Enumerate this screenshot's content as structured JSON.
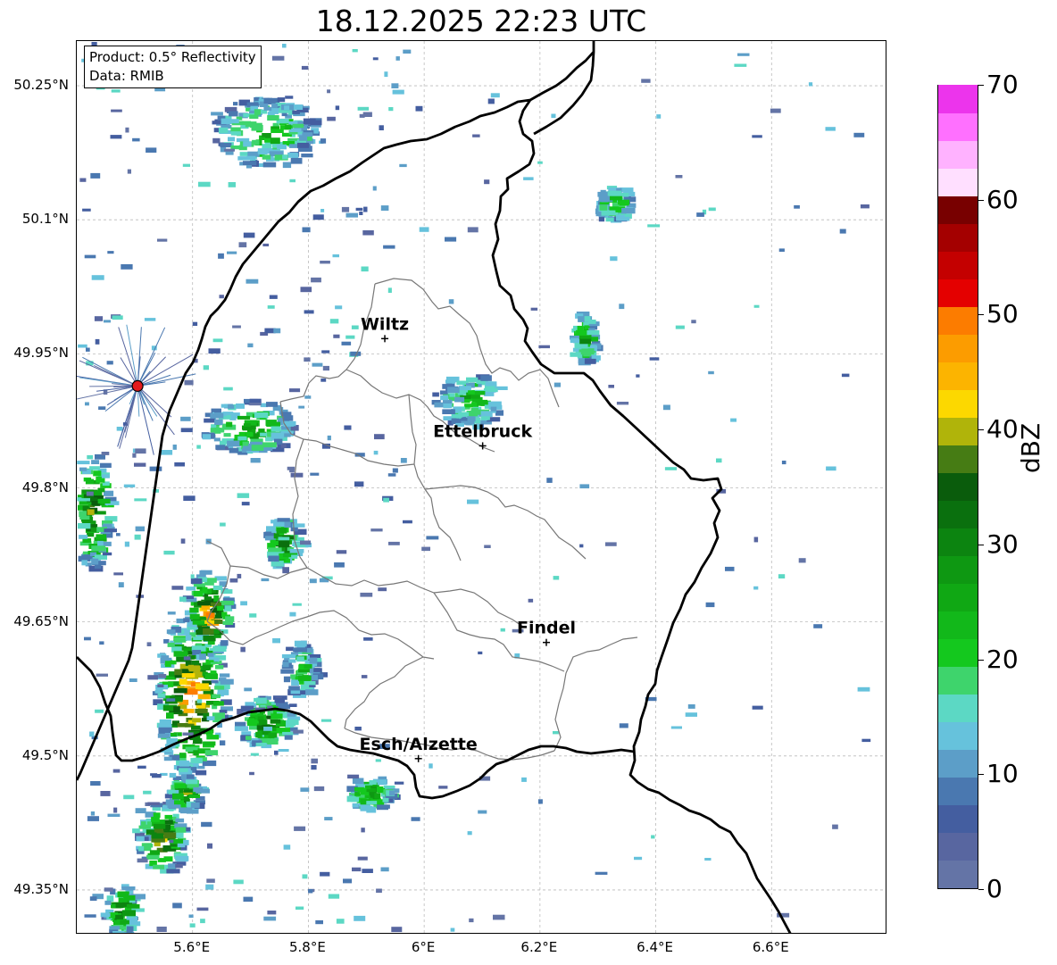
{
  "title": "18.12.2025 22:23 UTC",
  "info_box": {
    "product": "Product: 0.5° Reflectivity",
    "data": "Data: RMIB"
  },
  "axes": {
    "lon_range": [
      5.4,
      6.8
    ],
    "lat_range": [
      49.3,
      50.3
    ],
    "lat_ticks": [
      {
        "value": 50.25,
        "label": "50.25°N"
      },
      {
        "value": 50.1,
        "label": "50.1°N"
      },
      {
        "value": 49.95,
        "label": "49.95°N"
      },
      {
        "value": 49.8,
        "label": "49.8°N"
      },
      {
        "value": 49.65,
        "label": "49.65°N"
      },
      {
        "value": 49.5,
        "label": "49.5°N"
      },
      {
        "value": 49.35,
        "label": "49.35°N"
      }
    ],
    "lon_ticks": [
      {
        "value": 5.6,
        "label": "5.6°E"
      },
      {
        "value": 5.8,
        "label": "5.8°E"
      },
      {
        "value": 6.0,
        "label": "6°E"
      },
      {
        "value": 6.2,
        "label": "6.2°E"
      },
      {
        "value": 6.4,
        "label": "6.4°E"
      },
      {
        "value": 6.6,
        "label": "6.6°E"
      }
    ],
    "gridlines": true
  },
  "cities": [
    {
      "name": "Wiltz",
      "lon": 5.932,
      "lat": 49.967
    },
    {
      "name": "Ettelbruck",
      "lon": 6.101,
      "lat": 49.847
    },
    {
      "name": "Findel",
      "lon": 6.211,
      "lat": 49.627
    },
    {
      "name": "Esch/Alzette",
      "lon": 5.99,
      "lat": 49.497
    }
  ],
  "radar_site": {
    "lon": 5.505,
    "lat": 49.914,
    "color": "#e31a1c"
  },
  "colorbar": {
    "label": "dBZ",
    "min": 0,
    "max": 70,
    "ticks": [
      {
        "value": 0,
        "label": "0"
      },
      {
        "value": 10,
        "label": "10"
      },
      {
        "value": 20,
        "label": "20"
      },
      {
        "value": 30,
        "label": "30"
      },
      {
        "value": 40,
        "label": "40"
      },
      {
        "value": 50,
        "label": "50"
      },
      {
        "value": 60,
        "label": "60"
      },
      {
        "value": 70,
        "label": "70"
      }
    ],
    "colors": [
      "#6474a6",
      "#5866a0",
      "#445ea0",
      "#4a78b0",
      "#5c9ec8",
      "#66c2dc",
      "#5cd8c4",
      "#3ed46c",
      "#14c81e",
      "#12b81a",
      "#10a814",
      "#0e9812",
      "#0c8410",
      "#0a700e",
      "#0a5c0c",
      "#467c14",
      "#b0b40a",
      "#fcd800",
      "#fcb400",
      "#fc9c00",
      "#fc7c00",
      "#e40000",
      "#c40000",
      "#a40000",
      "#780000",
      "#ffdfff",
      "#ffb2ff",
      "#ff70ff",
      "#ec34ec"
    ]
  },
  "echo_clusters": [
    {
      "lon": 5.59,
      "lat": 49.57,
      "rx": 0.06,
      "ry": 0.09,
      "level": 22
    },
    {
      "lon": 5.62,
      "lat": 49.66,
      "rx": 0.04,
      "ry": 0.05,
      "level": 20
    },
    {
      "lon": 5.72,
      "lat": 49.54,
      "rx": 0.05,
      "ry": 0.03,
      "level": 14
    },
    {
      "lon": 5.54,
      "lat": 49.41,
      "rx": 0.04,
      "ry": 0.04,
      "level": 18
    },
    {
      "lon": 5.58,
      "lat": 49.46,
      "rx": 0.03,
      "ry": 0.02,
      "level": 16
    },
    {
      "lon": 5.47,
      "lat": 49.33,
      "rx": 0.03,
      "ry": 0.03,
      "level": 14
    },
    {
      "lon": 5.42,
      "lat": 49.78,
      "rx": 0.03,
      "ry": 0.07,
      "level": 16
    },
    {
      "lon": 5.75,
      "lat": 49.74,
      "rx": 0.03,
      "ry": 0.03,
      "level": 14
    },
    {
      "lon": 5.72,
      "lat": 50.2,
      "rx": 0.09,
      "ry": 0.04,
      "level": 10
    },
    {
      "lon": 5.69,
      "lat": 49.87,
      "rx": 0.08,
      "ry": 0.03,
      "level": 12
    },
    {
      "lon": 5.78,
      "lat": 49.6,
      "rx": 0.03,
      "ry": 0.03,
      "level": 10
    },
    {
      "lon": 5.9,
      "lat": 49.46,
      "rx": 0.04,
      "ry": 0.02,
      "level": 12
    },
    {
      "lon": 6.07,
      "lat": 49.9,
      "rx": 0.06,
      "ry": 0.03,
      "level": 10
    },
    {
      "lon": 6.27,
      "lat": 49.97,
      "rx": 0.02,
      "ry": 0.03,
      "level": 12
    },
    {
      "lon": 6.32,
      "lat": 50.12,
      "rx": 0.03,
      "ry": 0.02,
      "level": 10
    }
  ]
}
